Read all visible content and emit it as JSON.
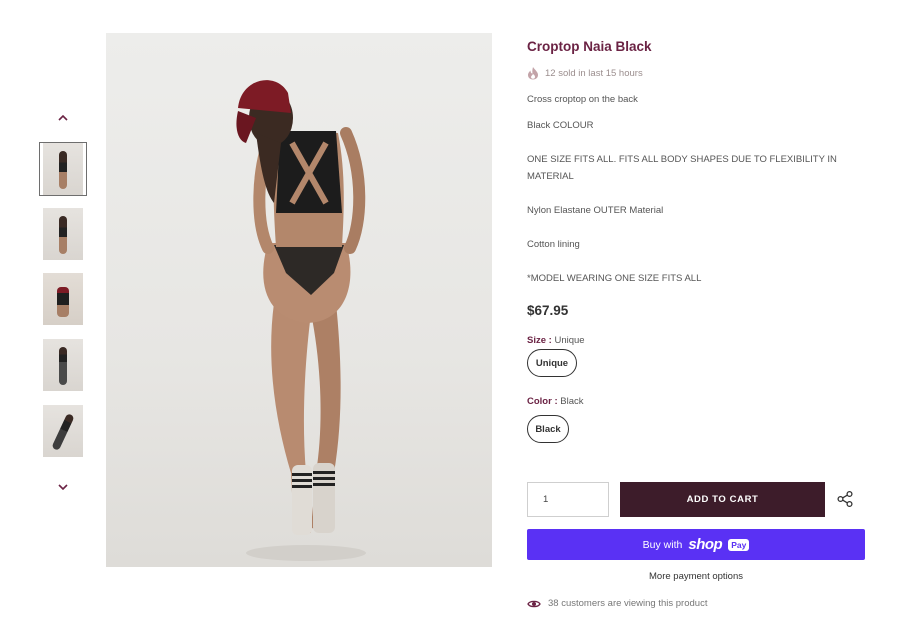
{
  "product": {
    "title": "Croptop Naia Black",
    "sold_text": "12 sold in last 15 hours",
    "description": [
      "Cross croptop on the back",
      "Black COLOUR",
      "ONE SIZE FITS ALL. FITS ALL BODY SHAPES DUE TO FLEXIBILITY IN MATERIAL",
      "Nylon Elastane OUTER Material",
      "Cotton lining",
      "*MODEL WEARING ONE SIZE FITS ALL"
    ],
    "price": "$67.95"
  },
  "options": {
    "size": {
      "label": "Size :",
      "selected": "Unique",
      "pill": "Unique"
    },
    "color": {
      "label": "Color :",
      "selected": "Black",
      "pill": "Black"
    }
  },
  "purchase": {
    "quantity": "1",
    "add_to_cart": "ADD TO CART",
    "buy_with": "Buy with",
    "shop_word": "shop",
    "pay_word": "Pay",
    "more_options": "More payment options",
    "viewing_text": "38 customers are viewing this product"
  },
  "colors": {
    "accent": "#6b2344",
    "cart_button": "#3d1c2a",
    "shop_pay": "#5a31f4"
  },
  "icons": {
    "sold": "flame-icon",
    "share": "share-icon",
    "viewing": "eye-icon",
    "up": "chevron-up-icon",
    "down": "chevron-down-icon"
  }
}
